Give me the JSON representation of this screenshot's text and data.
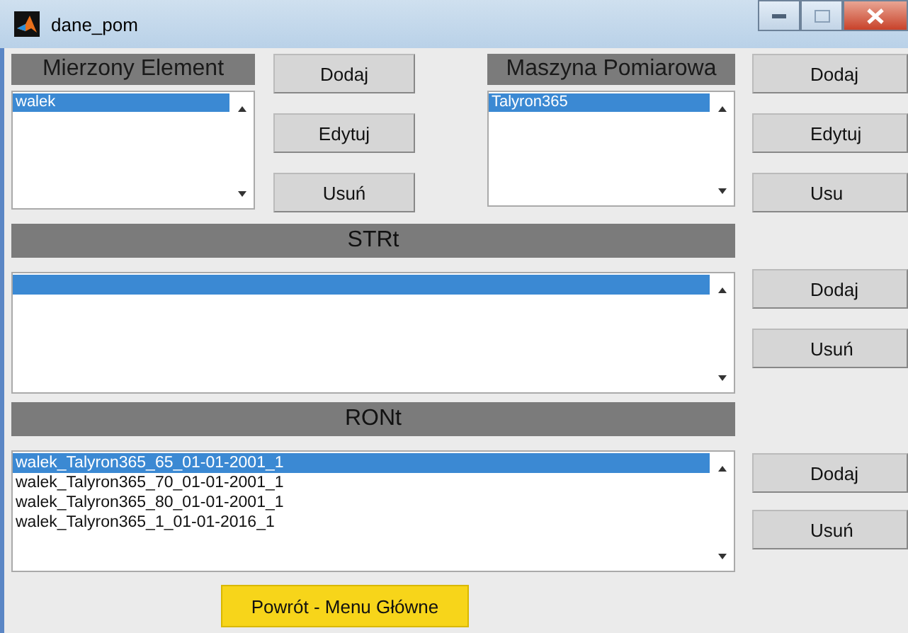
{
  "window": {
    "title": "dane_pom"
  },
  "element_panel": {
    "heading": "Mierzony Element",
    "items": [
      {
        "label": "walek",
        "selected": true
      }
    ],
    "buttons": [
      "Dodaj",
      "Edytuj",
      "Usuń"
    ]
  },
  "machine_panel": {
    "heading": "Maszyna Pomiarowa",
    "items": [
      {
        "label": "Talyron365",
        "selected": true
      }
    ],
    "buttons": [
      "Dodaj",
      "Edytuj",
      "Usu"
    ]
  },
  "strt_panel": {
    "heading": "STRt",
    "buttons": [
      "Dodaj",
      "Usuń"
    ]
  },
  "ront_panel": {
    "heading": "RONt",
    "items": [
      {
        "label": "walek_Talyron365_65_01-01-2001_1",
        "selected": true
      },
      {
        "label": "walek_Talyron365_70_01-01-2001_1",
        "selected": false
      },
      {
        "label": "walek_Talyron365_80_01-01-2001_1",
        "selected": false
      },
      {
        "label": "walek_Talyron365_1_01-01-2016_1",
        "selected": false
      }
    ],
    "buttons": [
      "Dodaj",
      "Usuń"
    ]
  },
  "footer_button": "Powrót - Menu Główne"
}
